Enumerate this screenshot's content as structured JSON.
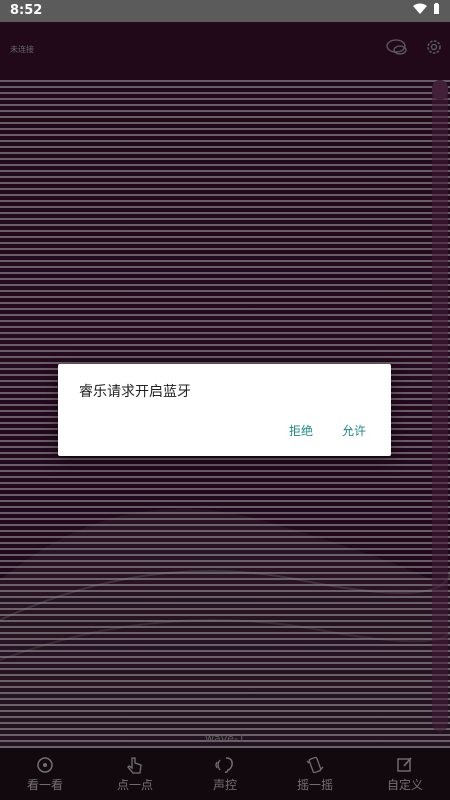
{
  "status_bar": {
    "time": "8:52"
  },
  "header": {
    "connection_status": "未连接"
  },
  "visualizer": {
    "wave_label": "wave-1"
  },
  "dialog": {
    "message": "睿乐请求开启蓝牙",
    "deny_label": "拒绝",
    "allow_label": "允许"
  },
  "bottom_nav": {
    "items": [
      {
        "label": "看一看",
        "icon": "look-icon"
      },
      {
        "label": "点一点",
        "icon": "tap-icon"
      },
      {
        "label": "声控",
        "icon": "voice-icon"
      },
      {
        "label": "摇一摇",
        "icon": "shake-icon"
      },
      {
        "label": "自定义",
        "icon": "edit-icon"
      }
    ]
  },
  "colors": {
    "accent": "#1b8a84",
    "header_bg": "#3c1230",
    "nav_bg": "#21121c"
  }
}
